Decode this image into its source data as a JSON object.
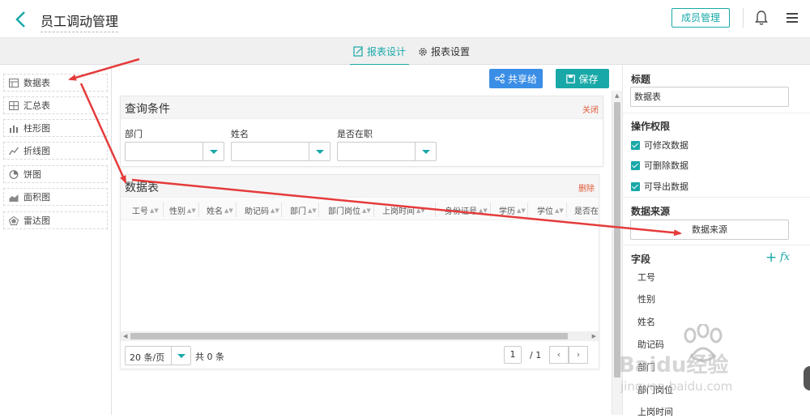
{
  "header": {
    "title": "员工调动管理",
    "member_button": "成员管理"
  },
  "tabs": [
    {
      "label": "报表设计",
      "active": true
    },
    {
      "label": "报表设置",
      "active": false
    }
  ],
  "left_panel": {
    "items": [
      {
        "label": "数据表",
        "icon": "table-icon"
      },
      {
        "label": "汇总表",
        "icon": "summary-table-icon"
      },
      {
        "label": "柱形图",
        "icon": "bar-chart-icon"
      },
      {
        "label": "折线图",
        "icon": "line-chart-icon"
      },
      {
        "label": "饼图",
        "icon": "pie-chart-icon"
      },
      {
        "label": "面积图",
        "icon": "area-chart-icon"
      },
      {
        "label": "雷达图",
        "icon": "radar-chart-icon"
      }
    ]
  },
  "toolbar": {
    "share_label": "共享给",
    "save_label": "保存"
  },
  "query_panel": {
    "title": "查询条件",
    "close_label": "关闭",
    "fields": [
      {
        "label": "部门",
        "value": ""
      },
      {
        "label": "姓名",
        "value": ""
      },
      {
        "label": "是否在职",
        "value": ""
      }
    ]
  },
  "data_panel": {
    "title": "数据表",
    "delete_label": "删除",
    "columns": [
      "工号",
      "性别",
      "姓名",
      "助记码",
      "部门",
      "部门岗位",
      "上岗时间",
      "身份证号",
      "学历",
      "学位",
      "是否在"
    ],
    "rows": [],
    "pager": {
      "page_size": "20 条/页",
      "total": "共 0 条",
      "current_page": "1",
      "page_count": "/ 1",
      "prev": "‹",
      "next": "›"
    }
  },
  "right_panel": {
    "title_label": "标题",
    "title_value": "数据表",
    "permissions_label": "操作权限",
    "permissions": [
      {
        "label": "可修改数据",
        "checked": true
      },
      {
        "label": "可删除数据",
        "checked": true
      },
      {
        "label": "可导出数据",
        "checked": true
      }
    ],
    "datasource_label": "数据来源",
    "datasource_button": "数据来源",
    "fields_label": "字段",
    "fields": [
      "工号",
      "性别",
      "姓名",
      "助记码",
      "部门",
      "部门岗位",
      "上岗时间"
    ]
  },
  "watermark": {
    "line1": "Baidu经验",
    "line2": "jingyan.baidu.com"
  },
  "colors": {
    "accent": "#19a8a8",
    "share": "#3a8ee6",
    "arrow": "#e53b3b",
    "danger": "#e05a3a"
  }
}
